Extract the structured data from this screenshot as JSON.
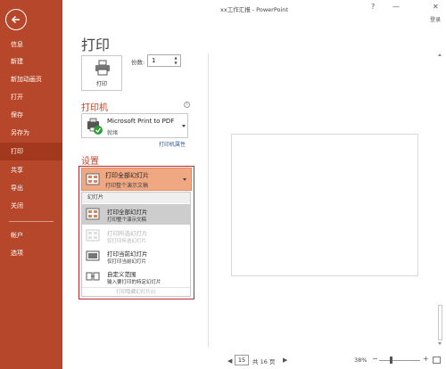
{
  "window": {
    "title": "xx工作汇报 - PowerPoint",
    "help": "?",
    "minimize": "—",
    "close": "✕",
    "signin": "登录"
  },
  "sidebar": {
    "items": [
      {
        "label": "信息",
        "active": false
      },
      {
        "label": "新建",
        "active": false
      },
      {
        "label": "新加动画页",
        "active": false
      },
      {
        "label": "打开",
        "active": false
      },
      {
        "label": "保存",
        "active": false
      },
      {
        "label": "另存为",
        "active": false
      },
      {
        "label": "打印",
        "active": true
      },
      {
        "label": "共享",
        "active": false
      },
      {
        "label": "导出",
        "active": false
      },
      {
        "label": "关闭",
        "active": false
      },
      {
        "label": "帐户",
        "active": false
      },
      {
        "label": "选项",
        "active": false
      }
    ]
  },
  "print": {
    "heading": "打印",
    "button_label": "打印",
    "copies_label": "份数:",
    "copies_value": "1"
  },
  "printer": {
    "section_title": "打印机",
    "info_glyph": "i",
    "name": "Microsoft Print to PDF",
    "status": "就绪",
    "properties_link": "打印机属性"
  },
  "settings": {
    "section_title": "设置",
    "selected_main": "打印全部幻灯片",
    "selected_sub": "打印整个演示文稿",
    "menu_header": "幻灯片",
    "options": [
      {
        "main": "打印全部幻灯片",
        "sub": "打印整个演示文稿",
        "selected": true,
        "enabled": true
      },
      {
        "main": "打印所选幻灯片",
        "sub": "仅打印所选幻灯片",
        "selected": false,
        "enabled": false
      },
      {
        "main": "打印当前幻灯片",
        "sub": "仅打印当前幻灯片",
        "selected": false,
        "enabled": true
      },
      {
        "main": "自定义范围",
        "sub": "输入要打印的特定幻灯片",
        "selected": false,
        "enabled": true
      }
    ],
    "footer": "打印隐藏幻灯片(I)"
  },
  "statusbar": {
    "prev": "◀",
    "page_input": "15",
    "page_total": "共 16 页",
    "next": "▶",
    "zoom_level": "38%",
    "zoom_minus": "−",
    "zoom_plus": "+",
    "zoom_fraction": 0.3
  },
  "colors": {
    "sidebar_bg": "#b7472a",
    "sidebar_active": "#a2391f",
    "accent_text": "#c0472a",
    "highlight_frame": "#c0262d",
    "selected_field": "#f0a882"
  }
}
